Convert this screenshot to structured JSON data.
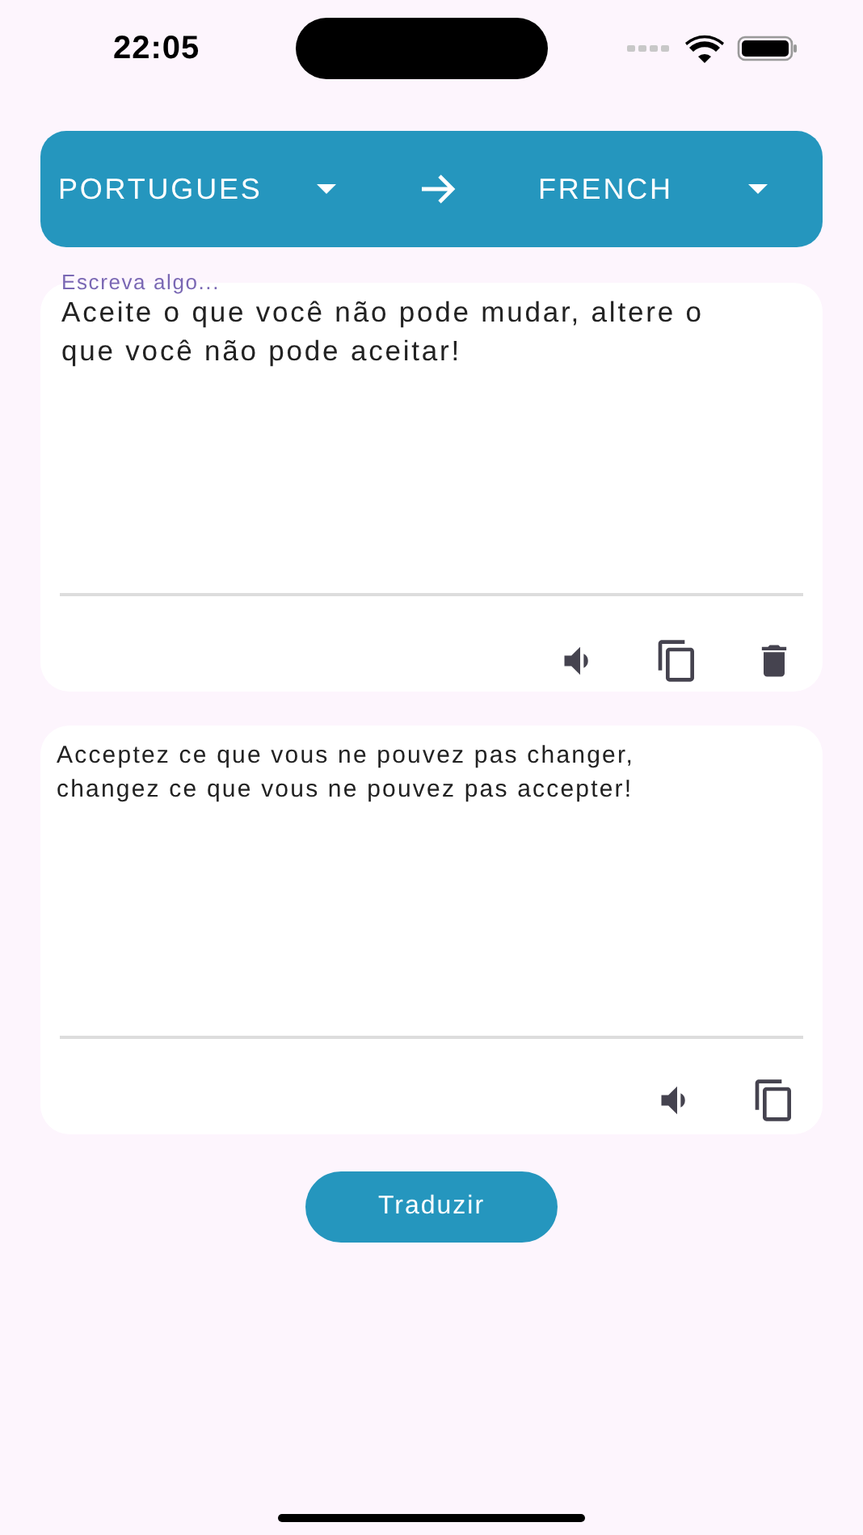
{
  "status_bar": {
    "time": "22:05"
  },
  "language_bar": {
    "source": "PORTUGUES",
    "target": "FRENCH"
  },
  "input": {
    "label": "Escreva algo...",
    "value": "Aceite o que você não pode mudar, altere o que você não pode aceitar!",
    "actions": [
      {
        "kind": "speak"
      },
      {
        "kind": "copy"
      },
      {
        "kind": "delete"
      }
    ]
  },
  "output": {
    "value": "Acceptez ce que vous ne pouvez pas changer, changez ce que vous ne pouvez pas accepter!",
    "actions": [
      {
        "kind": "speak"
      },
      {
        "kind": "copy"
      }
    ]
  },
  "translate_button": {
    "label": "Traduzir"
  }
}
